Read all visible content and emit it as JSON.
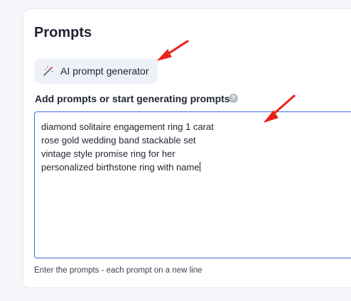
{
  "panel": {
    "title": "Prompts",
    "ai_button_label": "AI prompt generator",
    "field_label": "Add prompts or start generating prompts",
    "help_icon": "?",
    "prompts": [
      "diamond solitaire engagement ring 1 carat",
      "rose gold wedding band stackable set",
      "vintage style promise ring for her",
      "personalized birthstone ring with name"
    ],
    "hint": "Enter the prompts - each prompt on a new line"
  },
  "icons": {
    "ai_button": "magic-wand-icon",
    "help": "help-circle-icon"
  },
  "colors": {
    "textarea_focus_border": "#3b6fd8",
    "annotation_arrow": "#e8221b",
    "button_bg": "#eef1f8"
  }
}
